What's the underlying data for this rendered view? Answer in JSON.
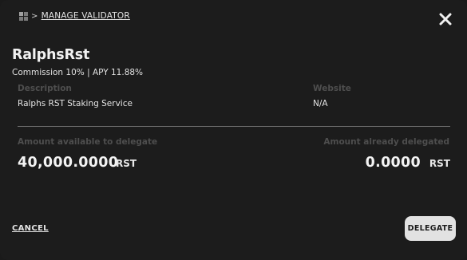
{
  "breadcrumb": {
    "separator": ">",
    "current": "MANAGE VALIDATOR"
  },
  "validator": {
    "name": "RalphsRst",
    "summary": "Commission 10% | APY 11.88%"
  },
  "details": {
    "description_label": "Description",
    "description_value": "Ralphs RST Staking Service",
    "website_label": "Website",
    "website_value": "N/A"
  },
  "amounts": {
    "available_label": "Amount available to delegate",
    "available_value": "40,000.0000",
    "available_unit": "RST",
    "delegated_label": "Amount already delegated",
    "delegated_value": "0.0000",
    "delegated_unit": "RST"
  },
  "actions": {
    "cancel_label": "CANCEL",
    "delegate_label": "DELEGATE"
  },
  "colors": {
    "background": "#1c1c1c",
    "muted_label": "#4e4e4e",
    "primary_button": "#e2e2e2"
  },
  "icons": {
    "breadcrumb_home": "grid-icon",
    "close": "close-icon"
  }
}
